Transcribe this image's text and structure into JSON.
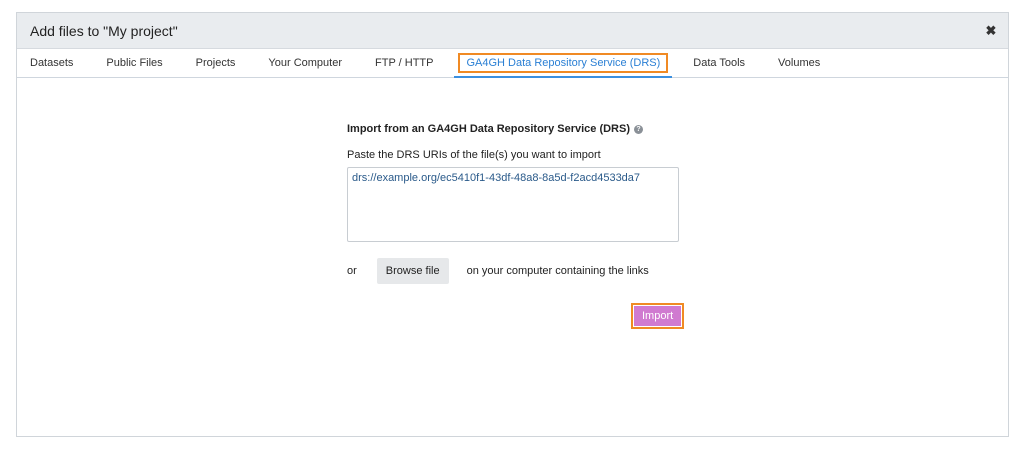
{
  "dialog": {
    "title": "Add files to \"My project\"",
    "close_icon": "close-icon"
  },
  "tabs": [
    {
      "label": "Datasets"
    },
    {
      "label": "Public Files"
    },
    {
      "label": "Projects"
    },
    {
      "label": "Your Computer"
    },
    {
      "label": "FTP / HTTP"
    },
    {
      "label": "GA4GH Data Repository Service (DRS)",
      "active": true
    },
    {
      "label": "Data Tools"
    },
    {
      "label": "Volumes"
    }
  ],
  "import_panel": {
    "heading": "Import from an GA4GH Data Repository Service (DRS)",
    "help_icon": "help-icon",
    "instruction": "Paste the DRS URIs of the file(s) you want to import",
    "uris_value": "drs://example.org/ec5410f1-43df-48a8-8a5d-f2acd4533da7",
    "or_text": "or",
    "browse_label": "Browse file",
    "browse_suffix": "on your computer containing the links",
    "import_label": "Import"
  },
  "colors": {
    "active_tab": "#2a7fd4",
    "highlight_outline": "#f08a24",
    "import_button": "#d07ad0"
  }
}
